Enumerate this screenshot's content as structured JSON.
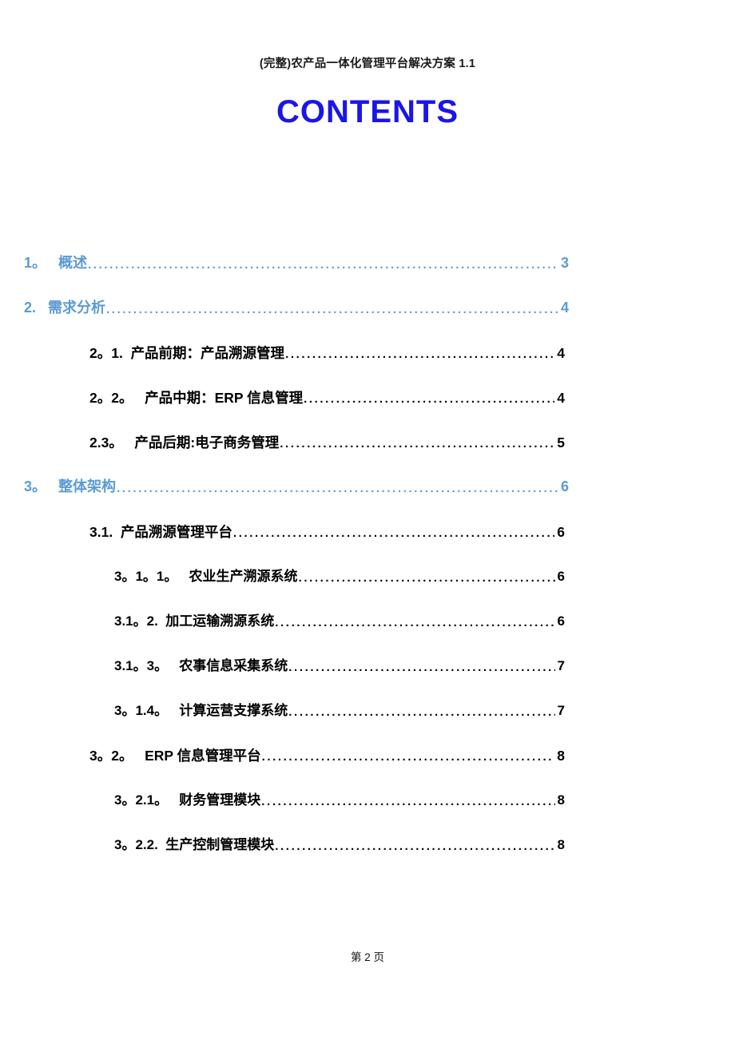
{
  "header": {
    "running_title": "(完整)农产品一体化管理平台解决方案 1.1"
  },
  "title": {
    "text": "CONTENTS",
    "color": "#1a16e8"
  },
  "footer": {
    "text": "第 2 页"
  },
  "colors": {
    "level1_blue": "#5b9bd5",
    "title_blue": "#1a16e8",
    "body_black": "#000000"
  },
  "toc": {
    "entries": [
      {
        "level": 1,
        "number": "1。",
        "label": "概述",
        "page": "3"
      },
      {
        "level": 1,
        "number": "2.",
        "label": "需求分析",
        "page": "4"
      },
      {
        "level": 2,
        "number": "2。1.",
        "label": "产品前期：产品溯源管理",
        "page": "4"
      },
      {
        "level": 2,
        "number": "2。2。",
        "label": " 产品中期：ERP 信息管理",
        "page": "4"
      },
      {
        "level": 2,
        "number": "2.3。",
        "label": " 产品后期:电子商务管理",
        "page": "5"
      },
      {
        "level": 1,
        "number": "3。",
        "label": "整体架构",
        "page": "6"
      },
      {
        "level": 2,
        "number": "3.1.",
        "label": "产品溯源管理平台",
        "page": "6"
      },
      {
        "level": 3,
        "number": "3。1。1。",
        "label": " 农业生产溯源系统",
        "page": "6"
      },
      {
        "level": 3,
        "number": "3.1。2.",
        "label": "加工运输溯源系统",
        "page": "6"
      },
      {
        "level": 3,
        "number": "3.1。3。",
        "label": " 农事信息采集系统",
        "page": "7"
      },
      {
        "level": 3,
        "number": "3。1.4。",
        "label": " 计算运营支撑系统",
        "page": "7"
      },
      {
        "level": 2,
        "number": "3。2。",
        "label": " ERP 信息管理平台",
        "page": "8"
      },
      {
        "level": 3,
        "number": "3。2.1。",
        "label": " 财务管理模块",
        "page": "8"
      },
      {
        "level": 3,
        "number": "3。2.2.",
        "label": "生产控制管理模块",
        "page": "8"
      }
    ]
  }
}
